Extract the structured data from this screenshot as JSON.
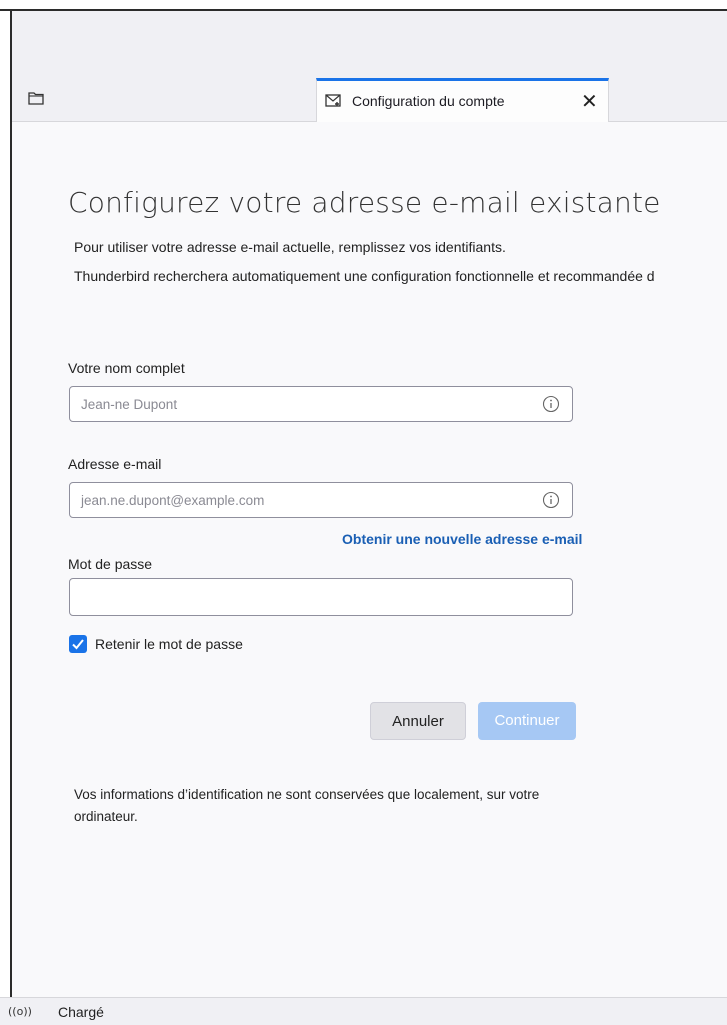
{
  "tab": {
    "label": "Configuration du compte",
    "close": "✕"
  },
  "page": {
    "title": "Configurez votre adresse e-mail existante",
    "desc1": "Pour utiliser votre adresse e-mail actuelle, remplissez vos identifiants.",
    "desc2": "Thunderbird recherchera automatiquement une configuration fonctionnelle et recommandée d"
  },
  "form": {
    "name_label": "Votre nom complet",
    "name_placeholder": "Jean-ne Dupont",
    "email_label": "Adresse e-mail",
    "email_placeholder": "jean.ne.dupont@example.com",
    "new_address_link": "Obtenir une nouvelle adresse e-mail",
    "password_label": "Mot de passe",
    "password_value": "",
    "remember_label": "Retenir le mot de passe",
    "remember_checked": true
  },
  "buttons": {
    "cancel": "Annuler",
    "continue": "Continuer"
  },
  "note": "Vos informations d’identification ne sont conservées que localement, sur votre ordinateur.",
  "status": {
    "icon": "((o))",
    "text": "Chargé"
  },
  "colors": {
    "accent": "#1a73e8",
    "link": "#1a5fb4",
    "continue_disabled": "#a6c8f4"
  }
}
